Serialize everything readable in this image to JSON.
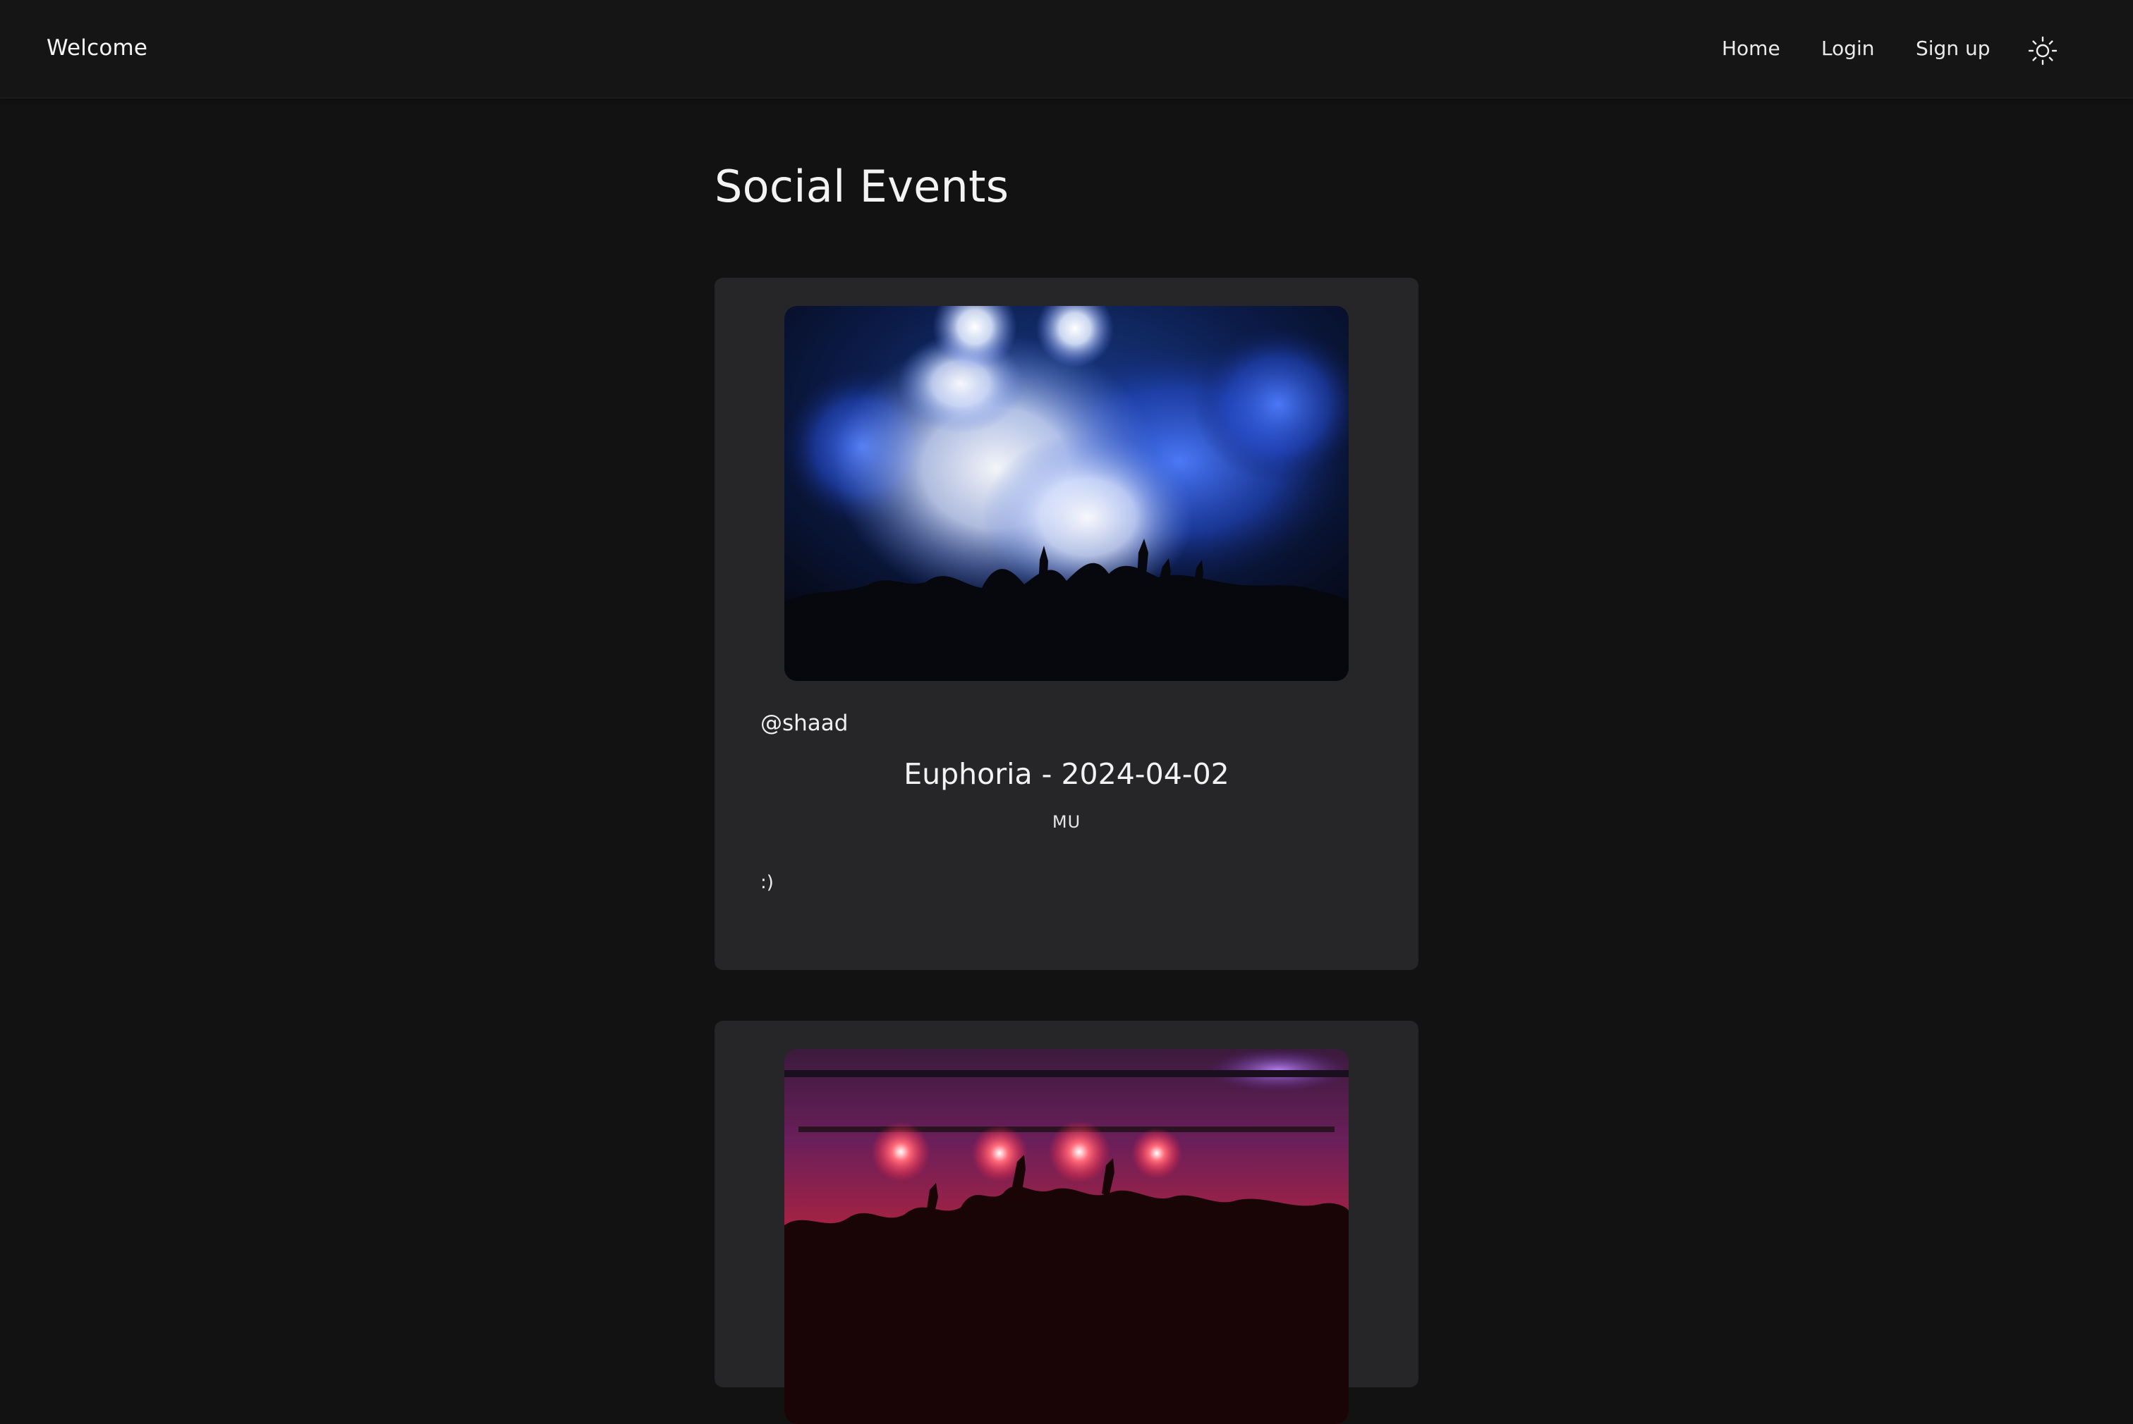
{
  "navbar": {
    "brand": "Welcome",
    "links": [
      "Home",
      "Login",
      "Sign up"
    ],
    "theme_toggle_icon": "sun-icon"
  },
  "page": {
    "title": "Social Events"
  },
  "events": [
    {
      "username": "@shaad",
      "title": "Euphoria - 2024-04-02",
      "location": "MU",
      "description": ":)",
      "image": "concert-blue-smoke-image"
    },
    {
      "image": "concert-red-lights-image"
    }
  ],
  "colors": {
    "background": "#121212",
    "navbar": "#151515",
    "card": "#262628",
    "text": "#f2f2f2"
  }
}
